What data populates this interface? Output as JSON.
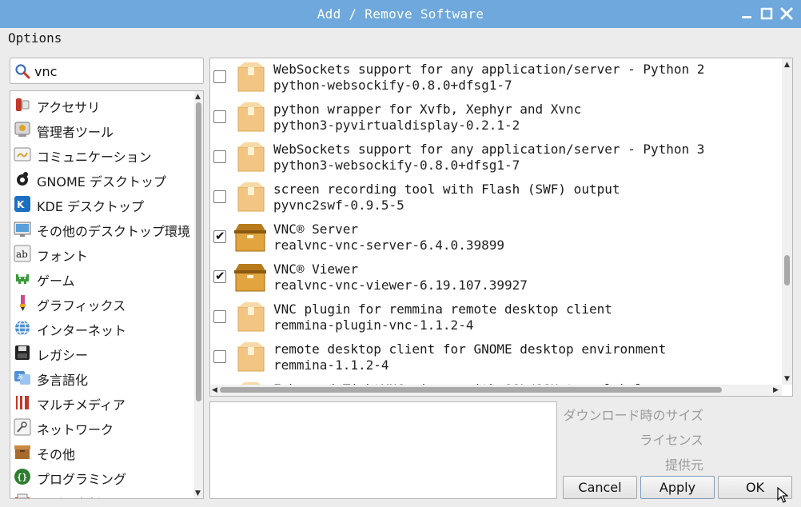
{
  "window": {
    "title": "Add / Remove Software"
  },
  "menu": {
    "options": "Options"
  },
  "search": {
    "value": "vnc"
  },
  "categories": [
    {
      "label": "アクセサリ",
      "icon": "accessories-icon"
    },
    {
      "label": "管理者ツール",
      "icon": "admin-tools-icon"
    },
    {
      "label": "コミュニケーション",
      "icon": "communication-icon"
    },
    {
      "label": "GNOME デスクトップ",
      "icon": "gnome-icon"
    },
    {
      "label": "KDE デスクトップ",
      "icon": "kde-icon"
    },
    {
      "label": "その他のデスクトップ環境",
      "icon": "desktop-other-icon"
    },
    {
      "label": "フォント",
      "icon": "fonts-icon"
    },
    {
      "label": "ゲーム",
      "icon": "games-icon"
    },
    {
      "label": "グラフィックス",
      "icon": "graphics-icon"
    },
    {
      "label": "インターネット",
      "icon": "internet-icon"
    },
    {
      "label": "レガシー",
      "icon": "legacy-icon"
    },
    {
      "label": "多言語化",
      "icon": "localization-icon"
    },
    {
      "label": "マルチメディア",
      "icon": "multimedia-icon"
    },
    {
      "label": "ネットワーク",
      "icon": "network-icon"
    },
    {
      "label": "その他",
      "icon": "other-icon"
    },
    {
      "label": "プログラミング",
      "icon": "programming-icon"
    },
    {
      "label": "印刷・出版",
      "icon": "publishing-icon"
    }
  ],
  "packages": [
    {
      "name": "WebSockets support for any application/server - Python 2",
      "version": "python-websockify-0.8.0+dfsg1-7",
      "checked": false,
      "installed": false
    },
    {
      "name": "python wrapper for Xvfb, Xephyr and Xvnc",
      "version": "python3-pyvirtualdisplay-0.2.1-2",
      "checked": false,
      "installed": false
    },
    {
      "name": "WebSockets support for any application/server - Python 3",
      "version": "python3-websockify-0.8.0+dfsg1-7",
      "checked": false,
      "installed": false
    },
    {
      "name": "screen recording tool with Flash (SWF) output",
      "version": "pyvnc2swf-0.9.5-5",
      "checked": false,
      "installed": false
    },
    {
      "name": "VNC® Server",
      "version": "realvnc-vnc-server-6.4.0.39899",
      "checked": true,
      "installed": true
    },
    {
      "name": "VNC® Viewer",
      "version": "realvnc-vnc-viewer-6.19.107.39927",
      "checked": true,
      "installed": true
    },
    {
      "name": "VNC plugin for remmina remote desktop client",
      "version": "remmina-plugin-vnc-1.1.2-4",
      "checked": false,
      "installed": false
    },
    {
      "name": "remote desktop client for GNOME desktop environment",
      "version": "remmina-1.1.2-4",
      "checked": false,
      "installed": false
    },
    {
      "name": "Enhanced TightVNC viewer with SSL/SSH tunnel helper",
      "version": "",
      "checked": false,
      "installed": false
    }
  ],
  "info": {
    "download_size": "ダウンロード時のサイズ",
    "license": "ライセンス",
    "provider": "提供元"
  },
  "buttons": {
    "cancel": "Cancel",
    "apply": "Apply",
    "ok": "OK"
  },
  "colors": {
    "titlebar": "#6ea8dc",
    "package_box": "#f2c583",
    "installed_box": "#e1a43e"
  }
}
